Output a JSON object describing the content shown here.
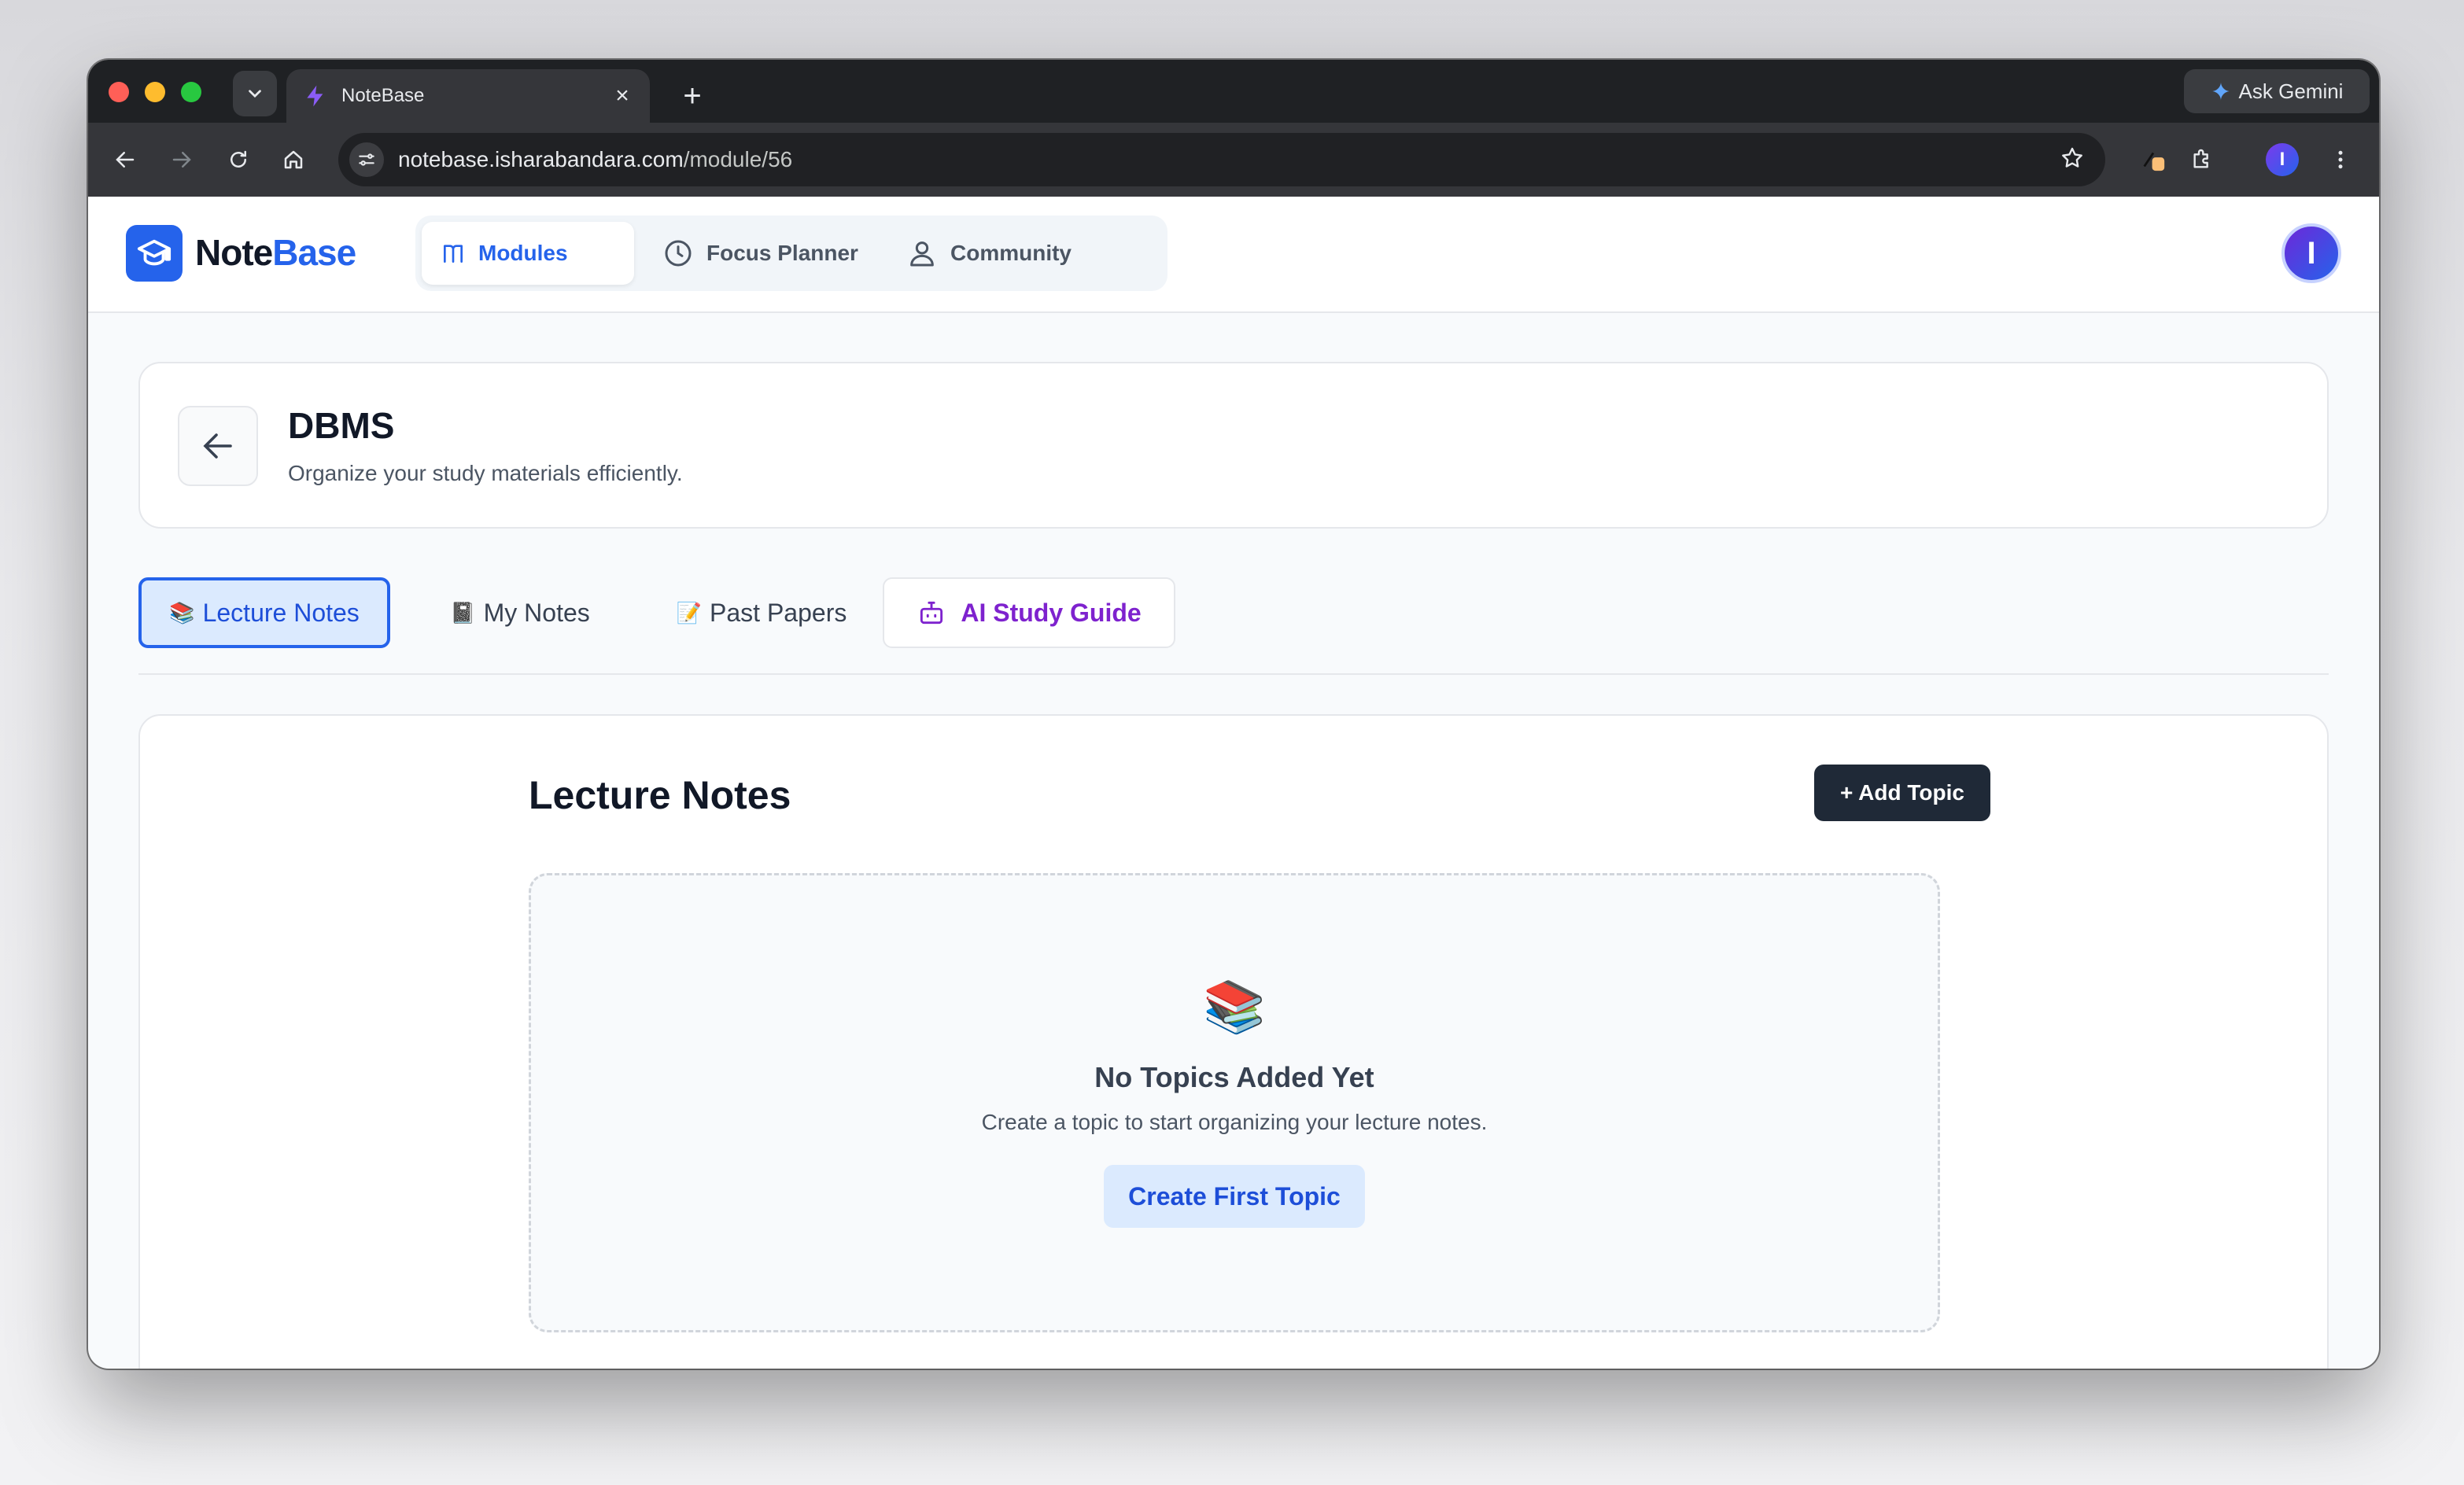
{
  "browser": {
    "tab_title": "NoteBase",
    "tab_close": "×",
    "new_tab": "+",
    "gemini_label": "Ask Gemini",
    "url_host": "notebase.isharabandara.com",
    "url_path": "/module/56",
    "profile_initial": "I"
  },
  "app": {
    "logo_part1": "Note",
    "logo_part2": "Base",
    "nav": [
      {
        "label": "Modules",
        "icon": "book-icon",
        "active": true
      },
      {
        "label": "Focus Planner",
        "icon": "clock-icon"
      },
      {
        "label": "Community",
        "icon": "users-icon"
      }
    ],
    "avatar_initial": "I",
    "brand_color": "#2563eb"
  },
  "module": {
    "title": "DBMS",
    "subtitle": "Organize your study materials efficiently."
  },
  "tabs": [
    {
      "emoji": "📚",
      "label": "Lecture Notes",
      "active": true
    },
    {
      "emoji": "📓",
      "label": "My Notes"
    },
    {
      "emoji": "📝",
      "label": "Past Papers"
    },
    {
      "label": "AI Study Guide",
      "icon": "robot-icon"
    }
  ],
  "content": {
    "title": "Lecture Notes",
    "add_button": "+ Add Topic",
    "empty": {
      "emoji": "📚",
      "title": "No Topics Added Yet",
      "description": "Create a topic to start organizing your lecture notes.",
      "button": "Create First Topic"
    }
  }
}
